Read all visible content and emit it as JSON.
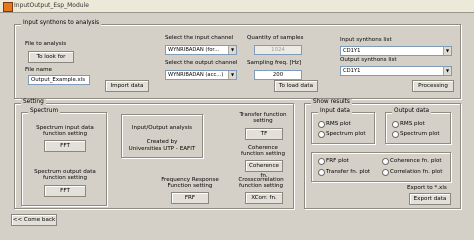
{
  "window": {
    "title": "InputOutput_Esp_Module"
  },
  "input_panel": {
    "title": "Input synthons to analysis",
    "file_to_analysis_label": "File to analysis",
    "to_look_for_button": "To look for",
    "file_name_label": "File name",
    "file_name_value": "Output_Example.xls",
    "import_data_button": "Import data",
    "select_input_channel_label": "Select the input channel",
    "input_channel_value": "WYNRIBADAN (for...",
    "select_output_channel_label": "Select the output channel",
    "output_channel_value": "WYNRIBADAN (acc...)",
    "quantity_samples_label": "Quantity of samples",
    "quantity_samples_value": "1024",
    "sampling_freq_label": "Sampling freq. [Hz]",
    "sampling_freq_value": "200",
    "to_load_data_button": "To load data",
    "input_synthons_list_label": "Input synthons list",
    "input_synthons_value": "CD1Y1",
    "output_synthons_list_label": "Output synthons list",
    "output_synthons_value": "CD1Y1",
    "processing_button": "Processing"
  },
  "setting_panel": {
    "title": "Setting",
    "spectrum": {
      "title": "Spectrum",
      "input_fn_label": "Spectrum input data function setting",
      "fft_button_1": "FFT",
      "output_fn_label": "Spectrum output data function setting",
      "fft_button_2": "FFT"
    },
    "info_box": {
      "line1": "Input/Output analysis",
      "line2": "Created by",
      "line3": "Universities UTP - EAFIT"
    },
    "transfer_label": "Transfer function setting",
    "tf_button": "TF",
    "coherence_label": "Coherence function setting",
    "coherence_button": "Coherence fn.",
    "frf_label": "Frequency Response Function setting",
    "frf_button": "FRF",
    "crosscorr_label": "Crosscorrelation function setting",
    "xcorr_button": "XCorr. fn."
  },
  "results_panel": {
    "title": "Show results",
    "input_data_group": {
      "title": "Input data",
      "rms_plot": "RMS plot",
      "spectrum_plot": "Spectrum plot"
    },
    "output_data_group": {
      "title": "Output data",
      "rms_plot": "RMS plot",
      "spectrum_plot": "Spectrum plot"
    },
    "frf_plot": "FRF plot",
    "transfer_plot": "Transfer fn. plot",
    "coherence_plot": "Coherence fn. plot",
    "correlation_plot": "Correlation fn. plot",
    "export_label": "Export to *.xls",
    "export_button": "Export data"
  },
  "come_back_button": "<< Come back"
}
